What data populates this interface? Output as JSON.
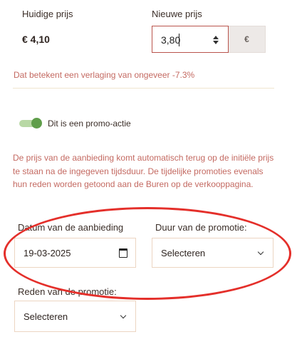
{
  "price": {
    "current_label": "Huidige prijs",
    "current_value": "€ 4,10",
    "new_label": "Nieuwe prijs",
    "new_value": "3,80",
    "currency_symbol": "€",
    "reduction_text": "Dat betekent een verlaging van ongeveer -7.3%"
  },
  "promo": {
    "toggle_label": "Dit is een promo-actie",
    "toggle_on": true,
    "info_text": "De prijs van de aanbieding komt automatisch terug op de initiële prijs te staan na de ingegeven tijdsduur. De tijdelijke promoties evenals hun reden worden getoond aan de Buren op de verkooppagina."
  },
  "offer_date": {
    "label": "Datum van de aanbieding",
    "value": "19-03-2025"
  },
  "promo_duration": {
    "label": "Duur van de promotie:",
    "value": "Selecteren"
  },
  "promo_reason": {
    "label": "Reden van de promotie:",
    "value": "Selecteren"
  },
  "colors": {
    "accent": "#b9544c",
    "hint_text": "#c46a62",
    "toggle_on": "#5f9e4a",
    "annotation": "#e42f2a"
  }
}
